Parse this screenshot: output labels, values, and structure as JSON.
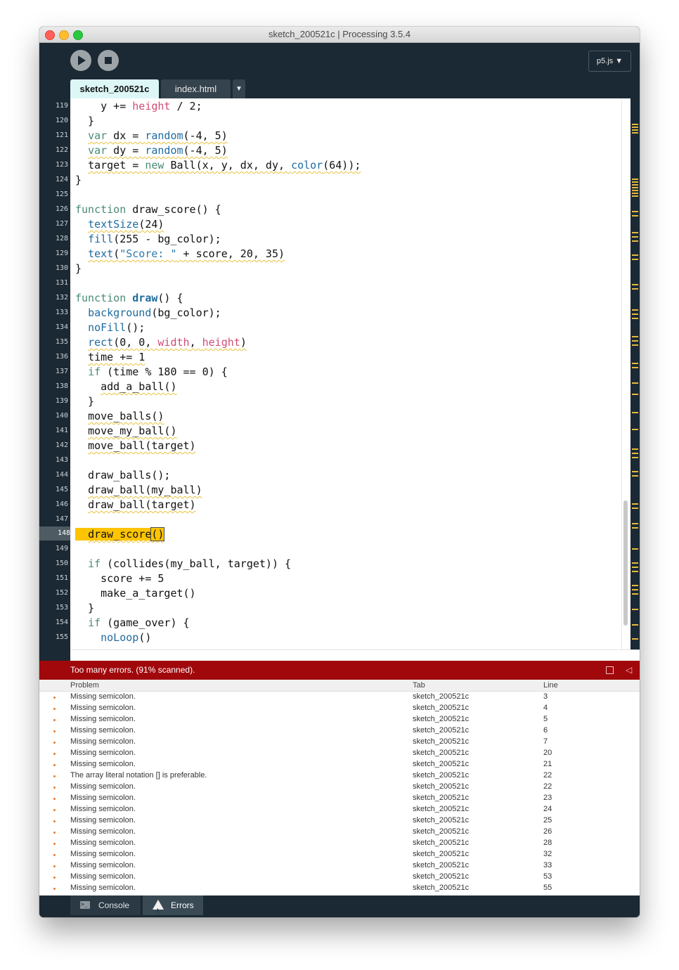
{
  "window": {
    "title": "sketch_200521c | Processing 3.5.4"
  },
  "toolbar": {
    "run_icon": "play-icon",
    "stop_icon": "stop-icon",
    "mode_label": "p5.js ▼"
  },
  "tabs": [
    {
      "label": "sketch_200521c",
      "active": true
    },
    {
      "label": "index.html",
      "active": false
    }
  ],
  "tabs_menu": "▼",
  "editor": {
    "current_line": "148",
    "line_numbers": [
      "119",
      "120",
      "121",
      "122",
      "123",
      "124",
      "125",
      "126",
      "127",
      "128",
      "129",
      "130",
      "131",
      "132",
      "133",
      "134",
      "135",
      "136",
      "137",
      "138",
      "139",
      "140",
      "141",
      "142",
      "143",
      "144",
      "145",
      "146",
      "147",
      "148",
      "149",
      "150",
      "151",
      "152",
      "153",
      "154",
      "155"
    ],
    "code_lines": [
      "    y += height / 2;",
      "  }",
      "  var dx = random(-4, 5)",
      "  var dy = random(-4, 5)",
      "  target = new Ball(x, y, dx, dy, color(64));",
      "}",
      "",
      "function draw_score() {",
      "  textSize(24)",
      "  fill(255 - bg_color);",
      "  text(\"Score: \" + score, 20, 35)",
      "}",
      "",
      "function draw() {",
      "  background(bg_color);",
      "  noFill();",
      "  rect(0, 0, width, height)",
      "  time += 1",
      "  if (time % 180 == 0) {",
      "    add_a_ball()",
      "  }",
      "  move_balls()",
      "  move_my_ball()",
      "  move_ball(target)",
      "",
      "  draw_balls();",
      "  draw_ball(my_ball)",
      "  draw_ball(target)",
      "",
      "  draw_score()",
      "",
      "  if (collides(my_ball, target)) {",
      "    score += 5",
      "    make_a_target()",
      "  }",
      "  if (game_over) {",
      "    noLoop()"
    ]
  },
  "errors": {
    "summary": "Too many errors. (91% scanned).",
    "columns": {
      "problem": "Problem",
      "tab": "Tab",
      "line": "Line"
    },
    "rows": [
      {
        "problem": "Missing semicolon.",
        "tab": "sketch_200521c",
        "line": "3"
      },
      {
        "problem": "Missing semicolon.",
        "tab": "sketch_200521c",
        "line": "4"
      },
      {
        "problem": "Missing semicolon.",
        "tab": "sketch_200521c",
        "line": "5"
      },
      {
        "problem": "Missing semicolon.",
        "tab": "sketch_200521c",
        "line": "6"
      },
      {
        "problem": "Missing semicolon.",
        "tab": "sketch_200521c",
        "line": "7"
      },
      {
        "problem": "Missing semicolon.",
        "tab": "sketch_200521c",
        "line": "20"
      },
      {
        "problem": "Missing semicolon.",
        "tab": "sketch_200521c",
        "line": "21"
      },
      {
        "problem": "The array literal notation [] is preferable.",
        "tab": "sketch_200521c",
        "line": "22"
      },
      {
        "problem": "Missing semicolon.",
        "tab": "sketch_200521c",
        "line": "22"
      },
      {
        "problem": "Missing semicolon.",
        "tab": "sketch_200521c",
        "line": "23"
      },
      {
        "problem": "Missing semicolon.",
        "tab": "sketch_200521c",
        "line": "24"
      },
      {
        "problem": "Missing semicolon.",
        "tab": "sketch_200521c",
        "line": "25"
      },
      {
        "problem": "Missing semicolon.",
        "tab": "sketch_200521c",
        "line": "26"
      },
      {
        "problem": "Missing semicolon.",
        "tab": "sketch_200521c",
        "line": "28"
      },
      {
        "problem": "Missing semicolon.",
        "tab": "sketch_200521c",
        "line": "32"
      },
      {
        "problem": "Missing semicolon.",
        "tab": "sketch_200521c",
        "line": "33"
      },
      {
        "problem": "Missing semicolon.",
        "tab": "sketch_200521c",
        "line": "53"
      },
      {
        "problem": "Missing semicolon.",
        "tab": "sketch_200521c",
        "line": "55"
      }
    ]
  },
  "footer": {
    "console_label": "Console",
    "errors_label": "Errors",
    "active": "Errors"
  },
  "colors": {
    "chrome": "#1b2934",
    "active_tab": "#ddf7f7",
    "error_bar": "#a0080c",
    "line_highlight": "#fdc403",
    "keyword": "#4a8b77",
    "function": "#1e6b9e",
    "builtin_var": "#d14c74"
  }
}
